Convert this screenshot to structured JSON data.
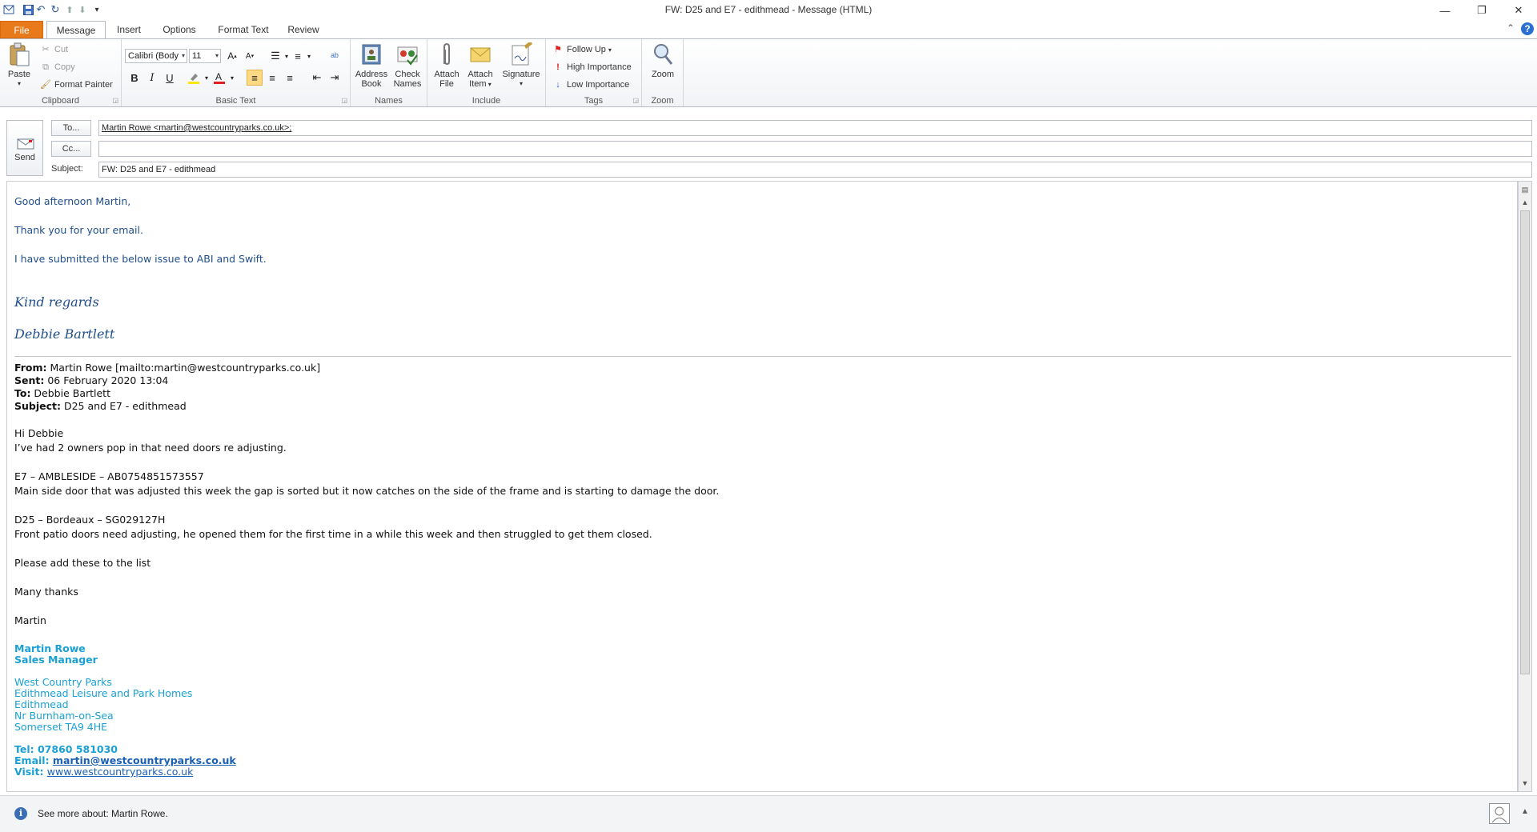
{
  "window": {
    "title": "FW: D25 and E7 - edithmead  -  Message (HTML)",
    "minimize": "—",
    "restore": "❐",
    "close": "✕"
  },
  "quick_access": [
    "save-icon",
    "undo-icon",
    "redo-icon",
    "up-icon",
    "down-icon",
    "customize-icon"
  ],
  "tabs": [
    "File",
    "Message",
    "Insert",
    "Options",
    "Format Text",
    "Review"
  ],
  "ribbon": {
    "clipboard": {
      "label": "Clipboard",
      "paste": "Paste",
      "cut": "Cut",
      "copy": "Copy",
      "format_painter": "Format Painter"
    },
    "basic_text": {
      "label": "Basic Text",
      "font": "Calibri (Body",
      "size": "11"
    },
    "names": {
      "label": "Names",
      "address_book_1": "Address",
      "address_book_2": "Book",
      "check_names_1": "Check",
      "check_names_2": "Names"
    },
    "include": {
      "label": "Include",
      "attach_file_1": "Attach",
      "attach_file_2": "File",
      "attach_item_1": "Attach",
      "attach_item_2": "Item",
      "signature": "Signature"
    },
    "tags": {
      "label": "Tags",
      "follow_up": "Follow Up",
      "high": "High Importance",
      "low": "Low Importance"
    },
    "zoom": {
      "label": "Zoom",
      "zoom": "Zoom"
    }
  },
  "header": {
    "send": "Send",
    "to_button": "To...",
    "cc_button": "Cc...",
    "subject_label": "Subject:",
    "to_value": "Martin Rowe <martin@westcountryparks.co.uk>;",
    "cc_value": "",
    "subject_value": "FW: D25 and E7 - edithmead"
  },
  "body": {
    "greeting": "Good afternoon Martin,",
    "thanks": "Thank you  for your email.",
    "submitted": "I have submitted the below issue to ABI and Swift.",
    "kind_regards": "Kind regards",
    "sender_name": "Debbie Bartlett",
    "fwd": {
      "from_label": "From:",
      "from_value": " Martin Rowe [mailto:martin@westcountryparks.co.uk]",
      "sent_label": "Sent:",
      "sent_value": " 06 February 2020 13:04",
      "to_label": "To:",
      "to_value": " Debbie Bartlett",
      "subject_label": "Subject:",
      "subject_value": " D25 and E7 - edithmead"
    },
    "hi": "Hi Debbie",
    "owners": "I’ve had 2 owners pop in that need doors re adjusting.",
    "e7_title": "E7 – AMBLESIDE – AB0754851573557",
    "e7_text": "Main side door that was adjusted this week the gap is sorted but it now catches on the side of the frame and is starting to damage the door.",
    "d25_title": "D25 – Bordeaux – SG029127H",
    "d25_text": "Front patio doors need adjusting, he opened them for the first time in a while this week and then struggled to get them closed.",
    "please_add": "Please add these to the list",
    "many_thanks": "Many thanks",
    "martin": "Martin",
    "signature": {
      "name": "Martin Rowe",
      "role": "Sales Manager",
      "company": "West Country Parks",
      "park": "Edithmead Leisure and Park Homes",
      "place": "Edithmead",
      "town": "Nr Burnham-on-Sea",
      "county": "Somerset TA9 4HE",
      "tel_label": "Tel: ",
      "tel": "07860 581030",
      "email_label": "Email: ",
      "email": "martin@westcountryparks.co.uk",
      "visit_label": "Visit: ",
      "visit": "www.westcountryparks.co.uk"
    }
  },
  "status": {
    "text": "See more about: Martin Rowe."
  },
  "colors": {
    "file_tab": "#e97a1c",
    "body_blue": "#1f4e8c",
    "signature_cyan": "#1aa0d4"
  }
}
